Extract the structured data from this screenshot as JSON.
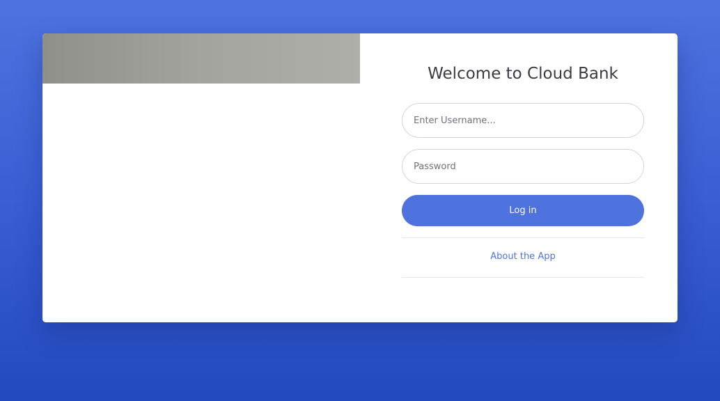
{
  "login": {
    "title": "Welcome to Cloud Bank",
    "username_placeholder": "Enter Username...",
    "password_placeholder": "Password",
    "login_label": "Log in",
    "about_label": "About the App"
  },
  "colors": {
    "primary": "#4e73df",
    "background_top": "#4e73df",
    "background_bottom": "#224abe",
    "title_text": "#3a3b45"
  }
}
